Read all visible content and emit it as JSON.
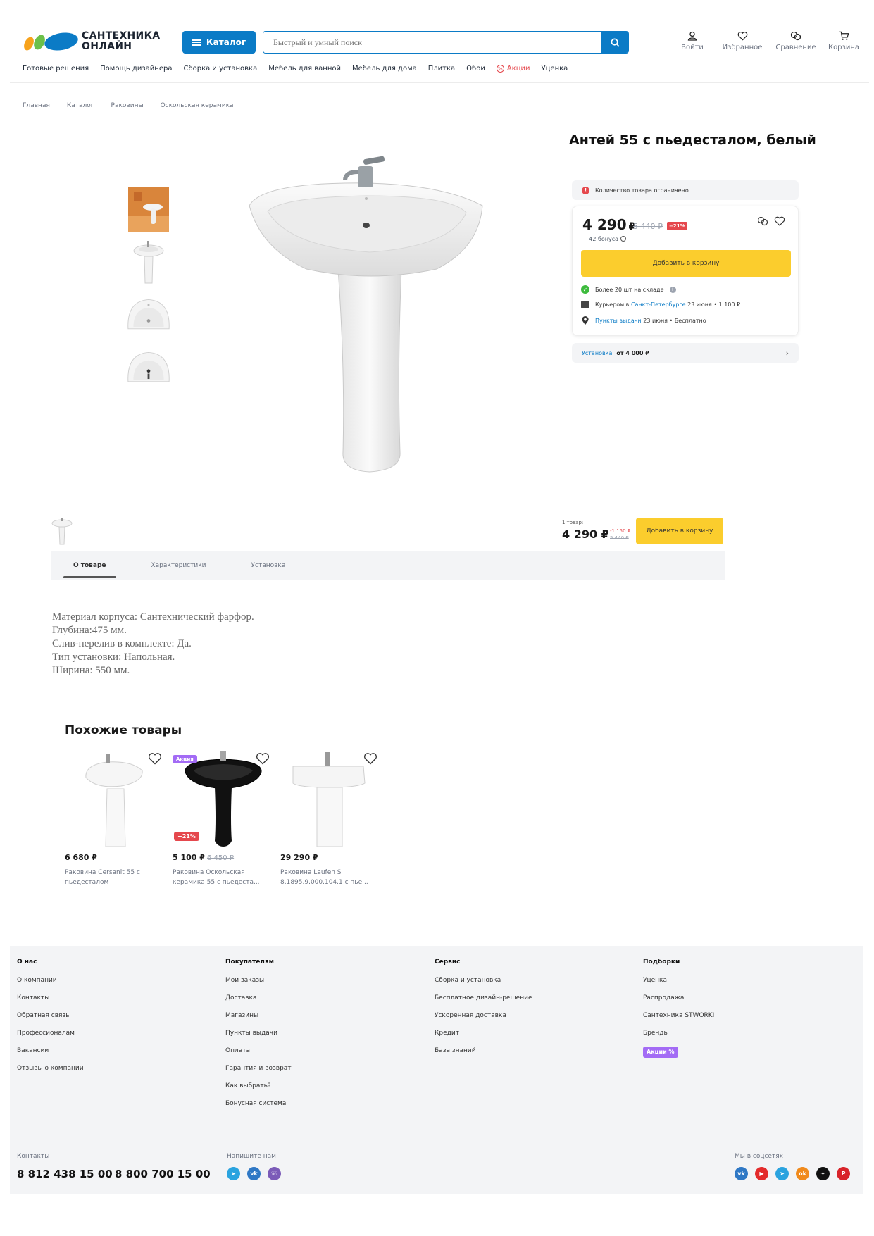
{
  "header": {
    "logo_line1": "САНТЕХНИКА",
    "logo_line2": "ОНЛАЙН",
    "catalog_label": "Каталог",
    "search_placeholder": "Быстрый и умный поиск",
    "actions": [
      {
        "label": "Войти",
        "icon": "user-icon"
      },
      {
        "label": "Избранное",
        "icon": "heart-icon"
      },
      {
        "label": "Сравнение",
        "icon": "compare-icon"
      },
      {
        "label": "Корзина",
        "icon": "cart-icon"
      }
    ],
    "nav": [
      "Готовые решения",
      "Помощь дизайнера",
      "Сборка и установка",
      "Мебель для ванной",
      "Мебель для дома",
      "Плитка",
      "Обои",
      "Акции",
      "Уценка"
    ]
  },
  "breadcrumbs": [
    "Главная",
    "Каталог",
    "Раковины",
    "Оскольская керамика"
  ],
  "product": {
    "title": "Антей 55 с пьедесталом, белый",
    "notice": "Количество товара ограничено",
    "price": "4 290",
    "currency": "₽",
    "old_price": "5 440 ₽",
    "discount": "−21%",
    "bonus": "+ 42 бонуса",
    "add_to_cart": "Добавить в корзину",
    "stock": "Более 20 шт на складе",
    "courier_prefix": "Курьером в",
    "courier_city": "Санкт-Петербурге",
    "courier_suffix": "23 июня • 1 100 ₽",
    "pickup_link": "Пункты выдачи",
    "pickup_suffix": "23 июня • Бесплатно",
    "install_link": "Установка",
    "install_price": "от 4 000 ₽"
  },
  "sticky": {
    "qty": "1 товар:",
    "price": "4 290 ₽",
    "discount": "-1 150 ₽",
    "old": "5 440 ₽",
    "button": "Добавить в корзину"
  },
  "tabs": [
    "О товаре",
    "Характеристики",
    "Установка"
  ],
  "description": [
    "Материал корпуса: Сантехнический фарфор.",
    "Глубина:475 мм.",
    "Слив-перелив в комплекте: Да.",
    "Тип установки: Напольная.",
    "Ширина: 550 мм."
  ],
  "similar": {
    "title": "Похожие товары",
    "items": [
      {
        "price": "6 680 ₽",
        "old": "",
        "name1": "Раковина Cersanit 55 с",
        "name2": "пьедесталом",
        "badge": "",
        "disc": ""
      },
      {
        "price": "5 100 ₽",
        "old": "6 450 ₽",
        "name1": "Раковина Оскольская",
        "name2": "керамика 55 с пьедеста...",
        "badge": "Акция",
        "disc": "−21%"
      },
      {
        "price": "29 290 ₽",
        "old": "",
        "name1": "Раковина Laufen S",
        "name2": "8.1895.9.000.104.1 с пье...",
        "badge": "",
        "disc": ""
      }
    ]
  },
  "footer": {
    "columns": [
      {
        "title": "О нас",
        "links": [
          "О компании",
          "Контакты",
          "Обратная связь",
          "Профессионалам",
          "Вакансии",
          "Отзывы о компании"
        ]
      },
      {
        "title": "Покупателям",
        "links": [
          "Мои заказы",
          "Доставка",
          "Магазины",
          "Пункты выдачи",
          "Оплата",
          "Гарантия и возврат",
          "Как выбрать?",
          "Бонусная система"
        ]
      },
      {
        "title": "Сервис",
        "links": [
          "Сборка и установка",
          "Бесплатное дизайн-решение",
          "Ускоренная доставка",
          "Кредит",
          "База знаний"
        ]
      },
      {
        "title": "Подборки",
        "links": [
          "Уценка",
          "Распродажа",
          "Сантехника STWORKI",
          "Бренды"
        ],
        "badge": "Акции %"
      }
    ],
    "contacts_label": "Контакты",
    "phone1": "8 812 438 15 00",
    "phone2": "8 800 700 15 00",
    "write_label": "Напишите нам",
    "social_label": "Мы в соцсетях",
    "messengers": [
      "telegram-icon",
      "vk-icon",
      "viber-icon"
    ],
    "socials": [
      "vk-icon",
      "youtube-icon",
      "telegram-icon",
      "ok-icon",
      "zen-icon",
      "pinterest-icon"
    ]
  },
  "colors": {
    "accent": "#0b7bc6",
    "cta": "#fbcd2d",
    "sale": "#e5484d",
    "promo": "#a36bf5"
  }
}
